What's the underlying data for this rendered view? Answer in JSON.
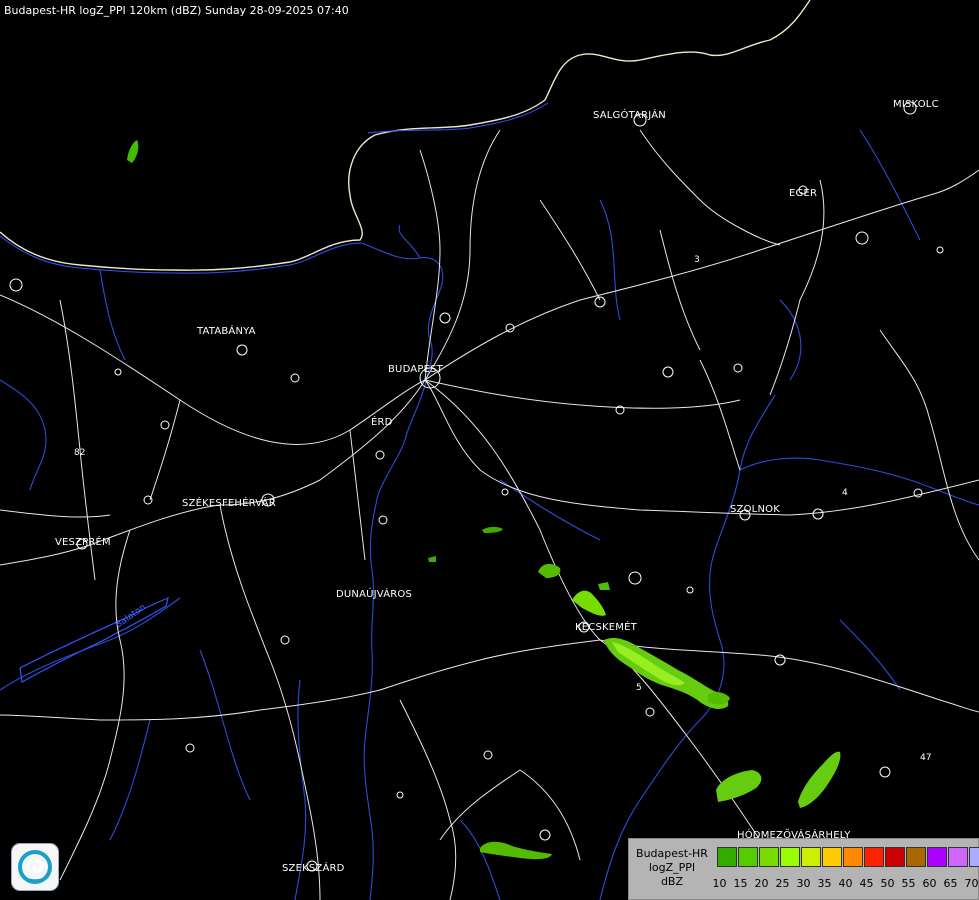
{
  "header": {
    "title": "Budapest-HR logZ_PPI 120km (dBZ) Sunday 28-09-2025 07:40"
  },
  "cities": {
    "salgotarjan": "SALGÓTARJÁN",
    "eger": "EGER",
    "miskolc": "MISKOLC",
    "tatabanya": "TATABÁNYA",
    "budapest": "BUDAPEST",
    "erd": "ÉRD",
    "szekesfehervar": "SZÉKESFEHÉRVÁR",
    "szolnok": "SZOLNOK",
    "veszprem": "VESZPRÉM",
    "dunaujvaros": "DUNAÚJVÁROS",
    "kecskemet": "KECSKEMÉT",
    "hodmezovasarhely": "HÓDMEZŐVÁSÁRHELY",
    "szekszard": "SZEKSZÁRD"
  },
  "roads": {
    "r82": "82",
    "r3": "3",
    "r4": "4",
    "r5": "5",
    "r47": "47"
  },
  "water": {
    "balaton": "Balaton"
  },
  "legend": {
    "line1": "Budapest-HR",
    "line2": "logZ_PPI",
    "line3": "dBZ",
    "ticks": [
      "10",
      "15",
      "20",
      "25",
      "30",
      "35",
      "40",
      "45",
      "50",
      "55",
      "60",
      "65",
      "70"
    ],
    "colors": [
      "#33aa00",
      "#55cc00",
      "#77dd00",
      "#99ff00",
      "#ccee00",
      "#ffcc00",
      "#ff8800",
      "#ff2200",
      "#cc0000",
      "#aa6600",
      "#aa00ff",
      "#cc66ff",
      "#aaaaff"
    ]
  },
  "logo": {
    "icon": "met-service-logo"
  }
}
